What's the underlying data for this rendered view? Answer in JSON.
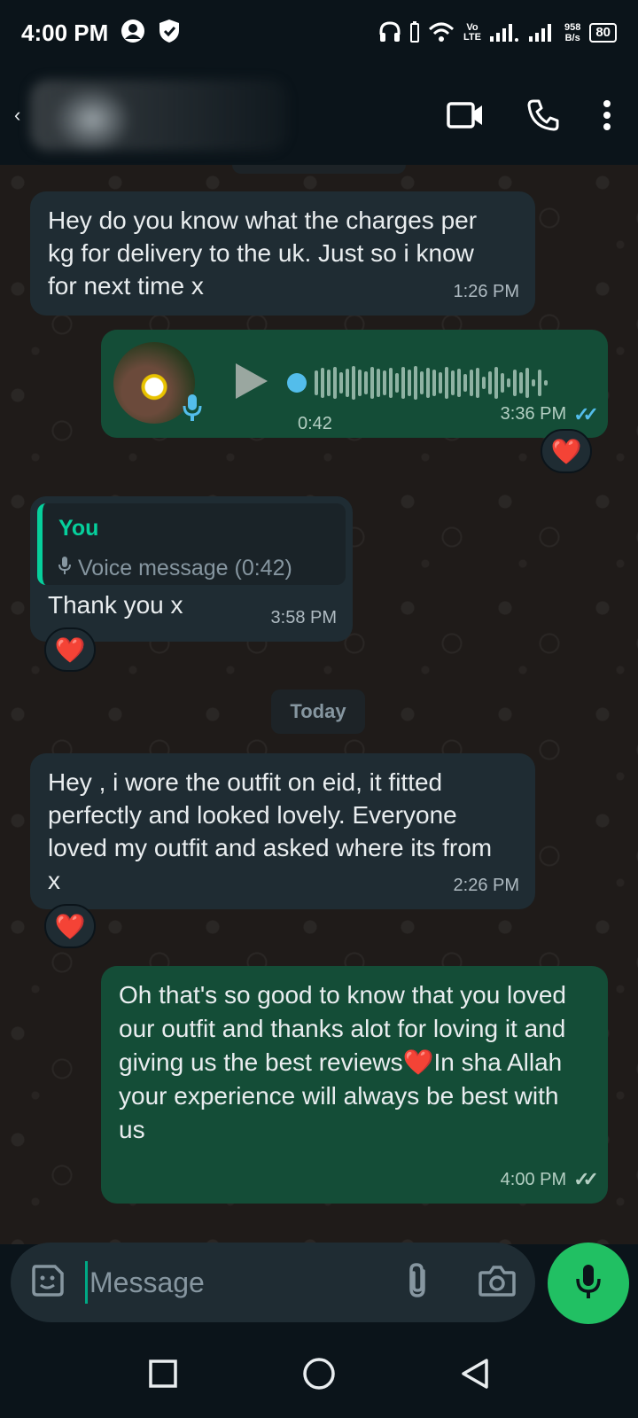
{
  "status_bar": {
    "time": "4:00 PM",
    "net_speed_value": "958",
    "net_speed_unit": "B/s",
    "battery": "80",
    "volte_top": "Vo",
    "volte_bottom": "LTE"
  },
  "header": {
    "back_icon": "back-arrow-icon",
    "video_call_icon": "video-camera-icon",
    "voice_call_icon": "phone-icon",
    "menu_icon": "more-vert-icon"
  },
  "messages": [
    {
      "direction": "incoming",
      "text": "Hey do you know what the charges per kg for delivery to the uk. Just so i know for next time x",
      "time": "1:26 PM"
    },
    {
      "direction": "outgoing",
      "type": "voice",
      "duration": "0:42",
      "time": "3:36 PM",
      "status": "read",
      "reaction": "❤️"
    },
    {
      "direction": "incoming",
      "quote_author": "You",
      "quote_text": "Voice message (0:42)",
      "text": "Thank you x",
      "time": "3:58 PM",
      "reaction": "❤️"
    },
    {
      "direction": "incoming",
      "text": "Hey , i wore the outfit on eid, it fitted perfectly and looked lovely. Everyone loved my outfit and asked where its from x",
      "time": "2:26 PM",
      "reaction": "❤️"
    },
    {
      "direction": "outgoing",
      "text_part1": "Oh that's so good to know that you loved our outfit and thanks alot for loving it and giving us the best reviews",
      "emoji": "❤️",
      "text_part2": "In sha Allah your experience will always be best with us",
      "time": "4:00 PM",
      "status": "delivered"
    }
  ],
  "date_divider": "Today",
  "composer": {
    "placeholder": "Message",
    "sticker_icon": "sticker-icon",
    "attach_icon": "paperclip-icon",
    "camera_icon": "camera-icon",
    "mic_icon": "mic-icon"
  },
  "colors": {
    "incoming_bubble": "#1f2c33",
    "outgoing_bubble": "#144d37",
    "accent": "#21c063",
    "read_ticks": "#53bdeb"
  }
}
